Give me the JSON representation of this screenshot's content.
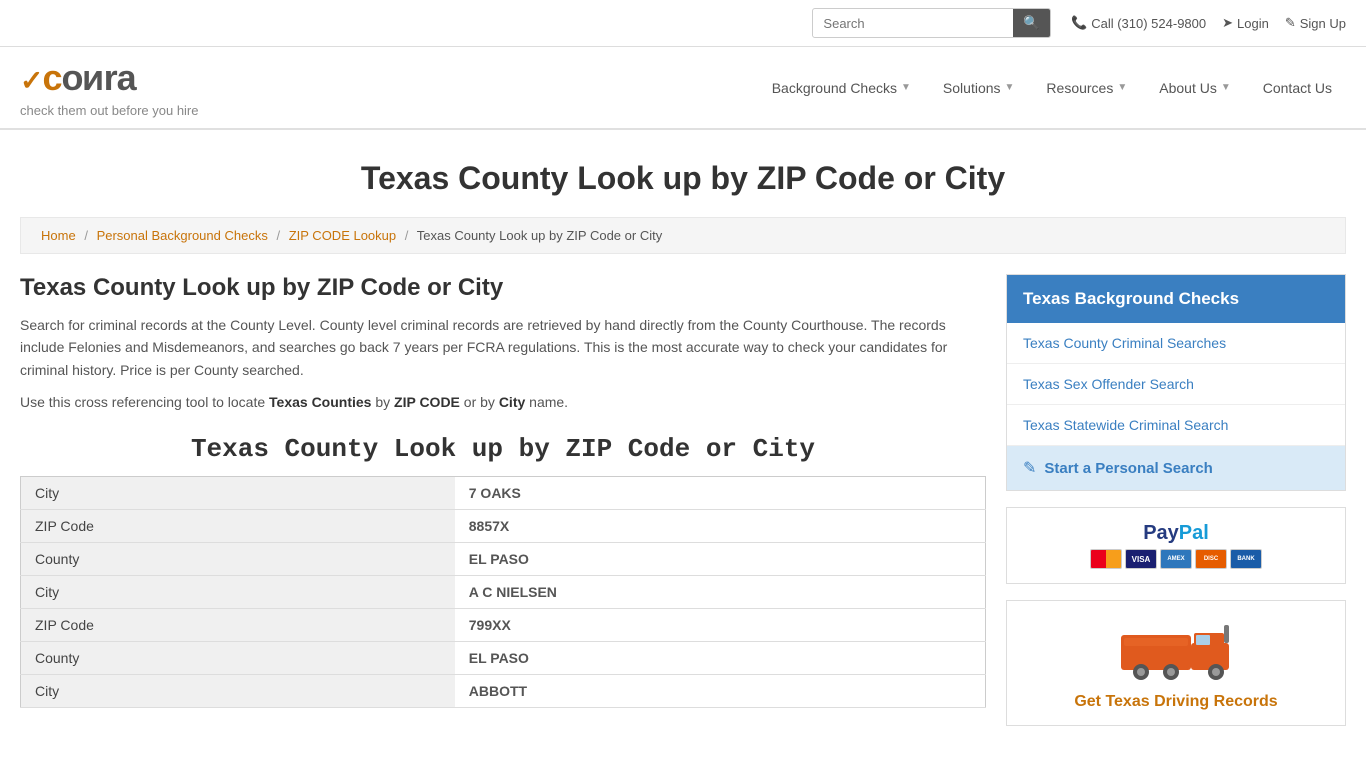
{
  "topbar": {
    "search_placeholder": "Search",
    "search_button_icon": "🔍",
    "call_label": "Call (310) 524-9800",
    "login_label": "Login",
    "signup_label": "Sign Up"
  },
  "navbar": {
    "logo_check": "✓",
    "logo_text": "COЯRA",
    "tagline": "check them out before you hire",
    "nav_items": [
      {
        "label": "Background Checks",
        "has_dropdown": true
      },
      {
        "label": "Solutions",
        "has_dropdown": true
      },
      {
        "label": "Resources",
        "has_dropdown": true
      },
      {
        "label": "About Us",
        "has_dropdown": true
      },
      {
        "label": "Contact Us",
        "has_dropdown": false
      }
    ]
  },
  "page": {
    "title": "Texas County Look up by ZIP Code or City",
    "breadcrumb": {
      "home": "Home",
      "personal": "Personal Background Checks",
      "zip": "ZIP CODE Lookup",
      "current": "Texas County Look up by ZIP Code or City"
    }
  },
  "content": {
    "heading": "Texas County Look up by ZIP Code or City",
    "para1": "Search for criminal records at the County Level. County level criminal records are retrieved by hand directly from the County Courthouse. The records include Felonies and Misdemeanors, and searches go back 7 years per FCRA regulations. This is the most accurate way to check your candidates for criminal history. Price is per County searched.",
    "para2_prefix": "Use this cross referencing tool to locate ",
    "para2_bold1": "Texas Counties",
    "para2_mid": " by ",
    "para2_bold2": "ZIP CODE",
    "para2_mid2": " or by ",
    "para2_bold3": "City",
    "para2_suffix": " name.",
    "table_title": "Texas County Look up by ZIP Code or City",
    "table_rows": [
      {
        "label": "City",
        "value": "7 OAKS"
      },
      {
        "label": "ZIP Code",
        "value": "8857X"
      },
      {
        "label": "County",
        "value": "EL PASO"
      },
      {
        "label": "City",
        "value": "A C NIELSEN"
      },
      {
        "label": "ZIP Code",
        "value": "799XX"
      },
      {
        "label": "County",
        "value": "EL PASO"
      },
      {
        "label": "City",
        "value": "ABBOTT"
      }
    ]
  },
  "sidebar": {
    "box1_title": "Texas Background Checks",
    "box1_links": [
      "Texas County Criminal Searches",
      "Texas Sex Offender Search",
      "Texas Statewide Criminal Search"
    ],
    "cta_label": "Start a Personal Search",
    "paypal_label": "PayPal",
    "cards": [
      "MC",
      "VISA",
      "AMEX",
      "DISC",
      "BANK"
    ],
    "driving_title": "Get Texas Driving Records"
  }
}
